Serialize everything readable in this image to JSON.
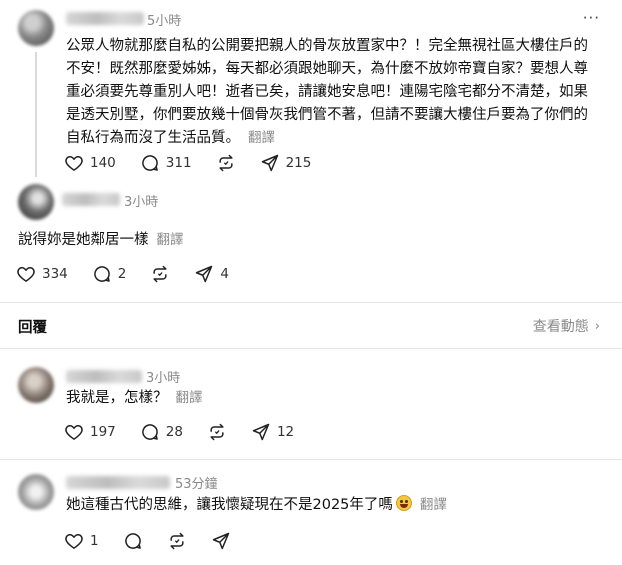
{
  "icons": {
    "like": "heart-icon",
    "comment": "comment-icon",
    "repost": "repost-icon",
    "share": "share-icon",
    "more": "more-icon"
  },
  "post1": {
    "time": "5小時",
    "more": "···",
    "lines": [
      "公眾人物就那麼自私的公開要把親人的骨灰放置家中？！完全無視社區大樓住戶的",
      "不安！既然那麼愛姊姊，每天都必須跟她聊天，為什麼不放妳帝寶自家？要想人尊",
      "重必須要先尊重別人吧！逝者已矣，請讓她安息吧！連陽宅陰宅都分不清楚，如果",
      "是透天別墅，你們要放幾十個骨灰我們管不著，但請不要讓大樓住戶要為了你們的",
      "自私行為而沒了生活品質。"
    ],
    "translate": "翻譯",
    "likes": "140",
    "comments": "311",
    "shares": "215"
  },
  "post2": {
    "time": "3小時",
    "text": "說得妳是她鄰居一樣",
    "translate": "翻譯",
    "likes": "334",
    "comments": "2",
    "shares": "4"
  },
  "reply_bar": {
    "title": "回覆",
    "view_activity": "查看動態",
    "chevron": "›"
  },
  "post3": {
    "time": "3小時",
    "text": "我就是，怎樣？",
    "translate": "翻譯",
    "likes": "197",
    "comments": "28",
    "shares": "12"
  },
  "post4": {
    "time": "53分鐘",
    "text": "她這種古代的思維，讓我懷疑現在不是2025年了嗎",
    "translate": "翻譯",
    "likes": "1"
  }
}
